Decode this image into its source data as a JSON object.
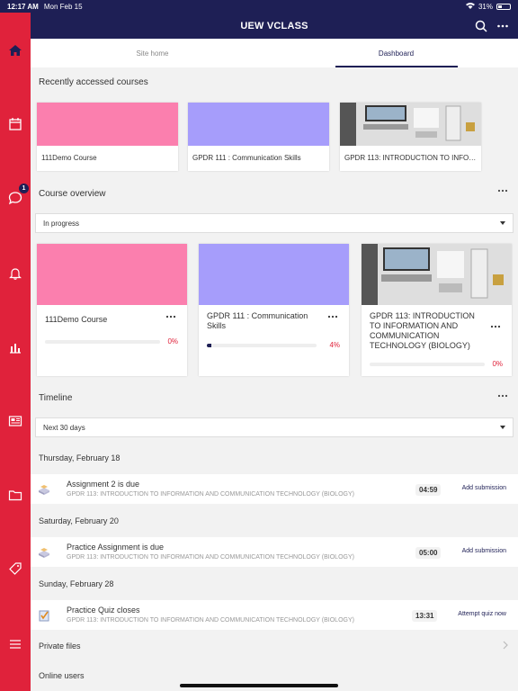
{
  "status": {
    "time": "12:17 AM",
    "date": "Mon Feb 15",
    "battery": "31%",
    "battery_level": 0.31
  },
  "header": {
    "title": "UEW VCLASS"
  },
  "tabs": [
    {
      "label": "Site home"
    },
    {
      "label": "Dashboard"
    }
  ],
  "sidebar": {
    "notification_count": "1"
  },
  "recent": {
    "title": "Recently accessed courses",
    "courses": [
      {
        "name": "111Demo Course",
        "color": "#fb7fae"
      },
      {
        "name": "GPDR 111 : Communication Skills",
        "color": "#a69dfb"
      },
      {
        "name": "GPDR 113: INTRODUCTION TO INFORMATION AND COMMUNICATION TECHNOLOGY (BIOLOGY)",
        "color": "#dcdcdc"
      }
    ]
  },
  "overview": {
    "title": "Course overview",
    "filter": "In progress",
    "courses": [
      {
        "name": "111Demo Course",
        "progress": "0%",
        "progress_value": 0,
        "color": "#fb7fae"
      },
      {
        "name": "GPDR 111 : Communication Skills",
        "progress": "4%",
        "progress_value": 0.04,
        "color": "#a69dfb"
      },
      {
        "name": "GPDR 113: INTRODUCTION TO INFORMATION AND COMMUNICATION TECHNOLOGY (BIOLOGY)",
        "progress": "0%",
        "progress_value": 0,
        "color": "#dcdcdc"
      }
    ]
  },
  "timeline": {
    "title": "Timeline",
    "filter": "Next 30 days",
    "groups": [
      {
        "date": "Thursday, February 18",
        "event": {
          "title": "Assignment 2 is due",
          "course": "GPDR 113: INTRODUCTION TO INFORMATION AND COMMUNICATION TECHNOLOGY (BIOLOGY)",
          "time": "04:59",
          "action": "Add submission",
          "icon": "assignment-icon"
        }
      },
      {
        "date": "Saturday, February 20",
        "event": {
          "title": "Practice Assignment is due",
          "course": "GPDR 113: INTRODUCTION TO INFORMATION AND COMMUNICATION TECHNOLOGY (BIOLOGY)",
          "time": "05:00",
          "action": "Add submission",
          "icon": "assignment-icon"
        }
      },
      {
        "date": "Sunday, February 28",
        "event": {
          "title": "Practice Quiz closes",
          "course": "GPDR 113: INTRODUCTION TO INFORMATION AND COMMUNICATION TECHNOLOGY (BIOLOGY)",
          "time": "13:31",
          "action": "Attempt quiz now",
          "icon": "quiz-icon"
        }
      }
    ]
  },
  "private_files": "Private files",
  "online_users": "Online users",
  "colors": {
    "primary": "#1e1f55",
    "accent": "#e0223b"
  }
}
